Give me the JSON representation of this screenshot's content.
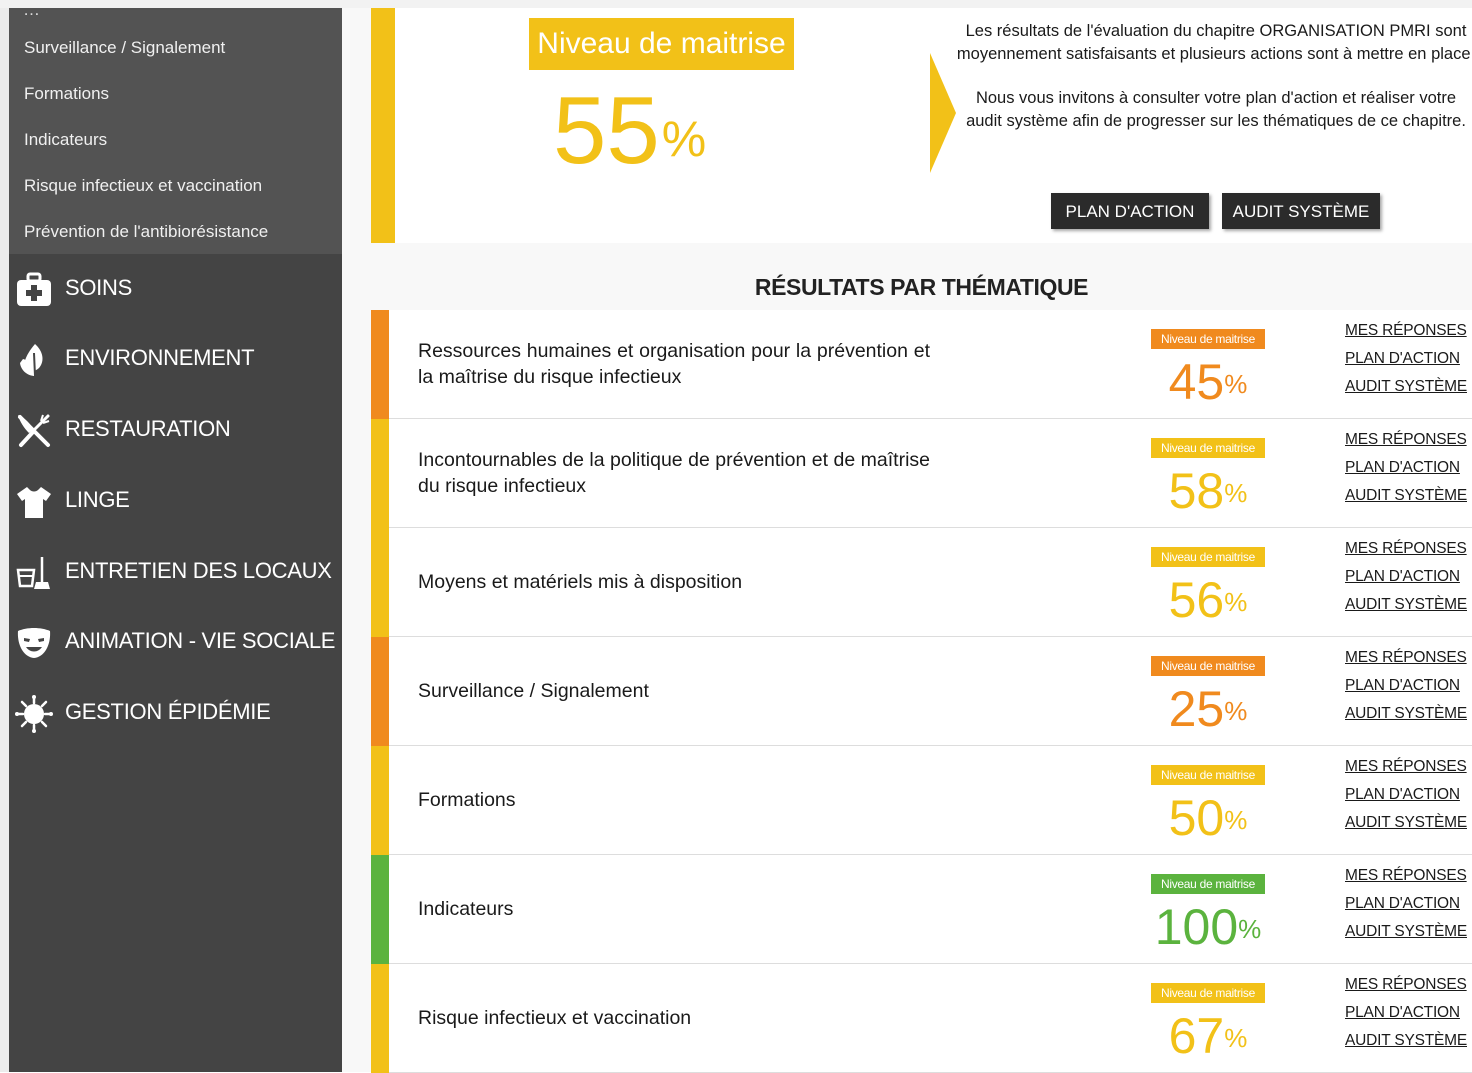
{
  "sidebar": {
    "submenu_cut": "…",
    "subitems": [
      {
        "label": "Surveillance / Signalement"
      },
      {
        "label": "Formations"
      },
      {
        "label": "Indicateurs"
      },
      {
        "label": "Risque infectieux et vaccination"
      },
      {
        "label": "Prévention de l'antibiorésistance"
      }
    ],
    "menu": [
      {
        "label": "SOINS",
        "icon": "medical-kit-icon"
      },
      {
        "label": "ENVIRONNEMENT",
        "icon": "leaf-icon"
      },
      {
        "label": "RESTAURATION",
        "icon": "utensils-icon"
      },
      {
        "label": "LINGE",
        "icon": "tshirt-icon"
      },
      {
        "label": "ENTRETIEN DES LOCAUX",
        "icon": "bucket-broom-icon"
      },
      {
        "label": "ANIMATION - VIE SOCIALE",
        "icon": "mask-icon"
      },
      {
        "label": "GESTION ÉPIDÉMIE",
        "icon": "virus-icon"
      }
    ]
  },
  "summary": {
    "badge": "Niveau de maitrise",
    "percent_value": "55",
    "percent_sign": "%",
    "text1": "Les résultats de l'évaluation du chapitre ORGANISATION PMRI sont moyennement satisfaisants et plusieurs actions sont à mettre en place.",
    "text2": "Nous vous invitons à consulter votre plan d'action et réaliser votre audit système afin de progresser sur les thématiques de ce chapitre.",
    "btn_plan": "PLAN D'ACTION",
    "btn_audit": "AUDIT SYSTÈME",
    "accent_color": "#f2c118"
  },
  "results": {
    "title": "RÉSULTATS PAR THÉMATIQUE",
    "badge_label": "Niveau de maitrise",
    "percent_sign": "%",
    "links": {
      "reponses": "MES RÉPONSES",
      "plan": "PLAN D'ACTION",
      "audit": "AUDIT SYSTÈME"
    },
    "colors": {
      "orange": "#f08a1e",
      "yellow": "#f2c118",
      "green": "#5bb33e"
    },
    "rows": [
      {
        "title": "Ressources humaines et organisation pour la prévention et la maîtrise du risque infectieux",
        "value": "45",
        "color": "#f08a1e"
      },
      {
        "title": "Incontournables de la politique de prévention et de maîtrise du risque infectieux",
        "value": "58",
        "color": "#f2c118"
      },
      {
        "title": "Moyens et matériels mis à disposition",
        "value": "56",
        "color": "#f2c118"
      },
      {
        "title": "Surveillance / Signalement",
        "value": "25",
        "color": "#f08a1e"
      },
      {
        "title": "Formations",
        "value": "50",
        "color": "#f2c118"
      },
      {
        "title": "Indicateurs",
        "value": "100",
        "color": "#5bb33e"
      },
      {
        "title": "Risque infectieux et vaccination",
        "value": "67",
        "color": "#f2c118"
      }
    ]
  }
}
